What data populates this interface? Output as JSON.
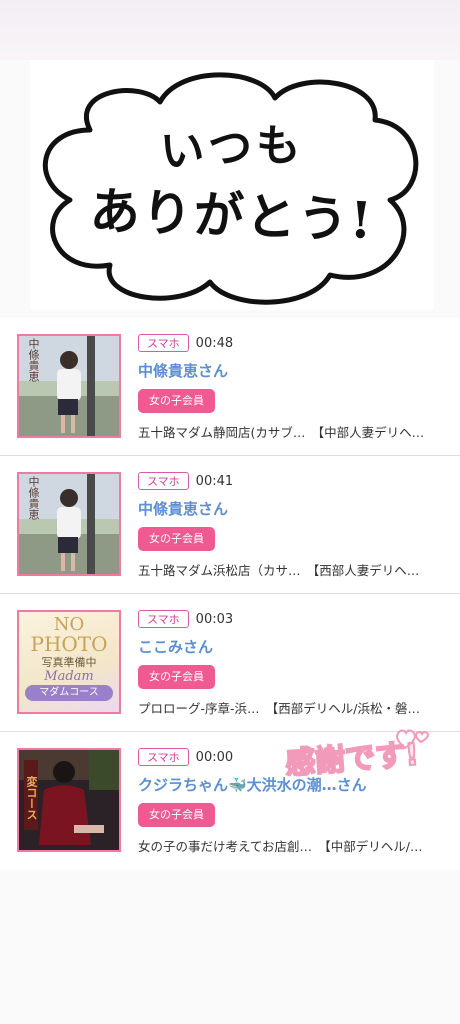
{
  "banner": {
    "line1": "いつも",
    "line2": "ありがとう!"
  },
  "items": [
    {
      "device": "スマホ",
      "time": "00:48",
      "name": "中條貴恵さん",
      "badge": "女の子会員",
      "shop": "五十路マダム静岡店(カサブ…　【中部人妻デリヘ…",
      "thumb_caption": "中條貴恵"
    },
    {
      "device": "スマホ",
      "time": "00:41",
      "name": "中條貴恵さん",
      "badge": "女の子会員",
      "shop": "五十路マダム浜松店（カサ…　【西部人妻デリヘ…",
      "thumb_caption": "中條貴恵"
    },
    {
      "device": "スマホ",
      "time": "00:03",
      "name": "ここみさん",
      "badge": "女の子会員",
      "shop": "プロローグ-序章-浜…　【西部デリヘル/浜松・磐…",
      "thumb_line1": "NO",
      "thumb_line2": "PHOTO",
      "thumb_line3": "写真準備中",
      "thumb_line4": "Madam",
      "thumb_line5": "マダムコース"
    },
    {
      "device": "スマホ",
      "time": "00:00",
      "name": "クジラちゃん🐳大洪水の潮…さん",
      "badge": "女の子会員",
      "shop": "女の子の事だけ考えてお店創…　【中部デリヘル/…",
      "thumb_caption": "変コース"
    }
  ],
  "stamp": "感謝です!",
  "colors": {
    "accent_pink": "#f05a93",
    "name_blue": "#5d8fd0",
    "thumb_border": "#f07aa3"
  }
}
